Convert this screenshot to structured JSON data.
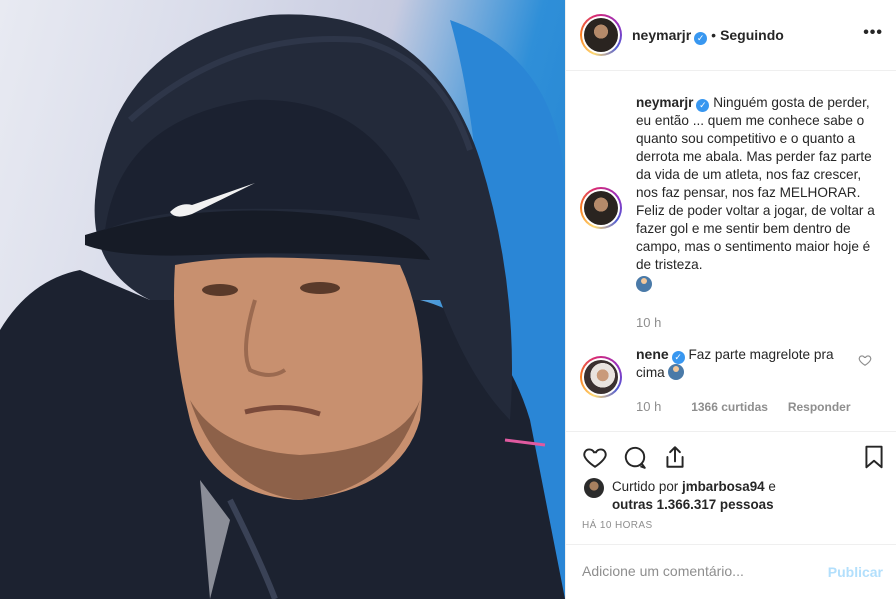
{
  "header": {
    "username": "neymarjr",
    "separator": "•",
    "follow_status": "Seguindo",
    "more_label": "•••"
  },
  "caption": {
    "username": "neymarjr",
    "text": "Ninguém gosta de perder, eu então ... quem me conhece sabe o quanto sou competitivo e o quanto a derrota me abala. Mas perder faz parte da vida de um atleta, nos faz crescer, nos faz pensar, nos faz MELHORAR. Feliz de poder voltar a jogar, de voltar a fazer gol e me sentir bem dentro de campo, mas o sentimento maior hoje é de tristeza.",
    "time": "10 h"
  },
  "comment": {
    "username": "nene",
    "text": "Faz parte magrelote pra cima",
    "time": "10 h",
    "likes": "1366 curtidas",
    "reply": "Responder"
  },
  "likes": {
    "prefix": "Curtido por",
    "user": "jmbarbosa94",
    "connector": "e",
    "others": "outras 1.366.317 pessoas"
  },
  "timestamp": "HÁ 10 HORAS",
  "comment_box": {
    "placeholder": "Adicione um comentário...",
    "post_label": "Publicar"
  },
  "icons": {
    "more": "more-options-icon",
    "verified": "verified-badge-icon",
    "like": "heart-icon",
    "comment": "comment-icon",
    "share": "share-icon",
    "save": "bookmark-icon"
  },
  "colors": {
    "verified_blue": "#3897f0",
    "muted_text": "#8e8e8e",
    "post_button_disabled": "#b2dffc",
    "divider": "#efefef"
  }
}
